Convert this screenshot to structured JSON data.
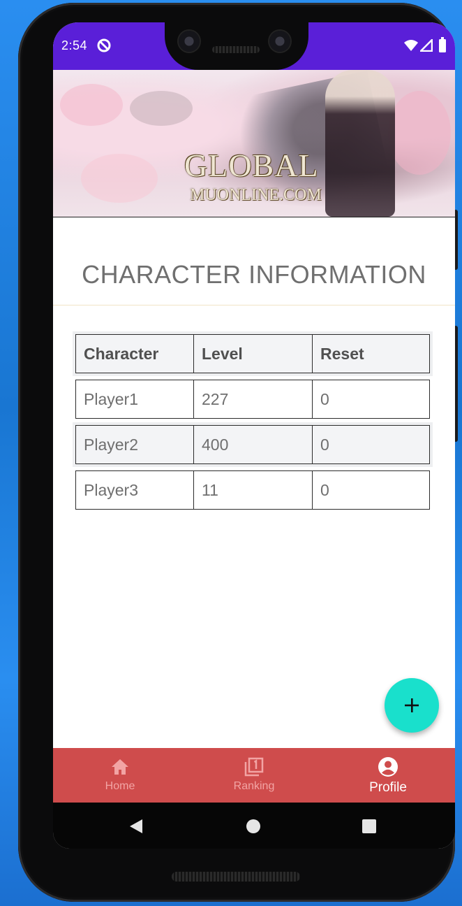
{
  "status_bar": {
    "time": "2:54",
    "icons": [
      "sync-icon",
      "wifi-icon",
      "signal-icon",
      "battery-icon"
    ]
  },
  "banner": {
    "logo_line1": "GLOBAL",
    "logo_line2": "MUONLINE.COM"
  },
  "page": {
    "title": "CHARACTER INFORMATION"
  },
  "table": {
    "headers": [
      "Character",
      "Level",
      "Reset"
    ],
    "rows": [
      [
        "Player1",
        "227",
        "0"
      ],
      [
        "Player2",
        "400",
        "0"
      ],
      [
        "Player3",
        "11",
        "0"
      ]
    ]
  },
  "fab": {
    "icon": "plus-icon"
  },
  "bottom_nav": {
    "items": [
      {
        "label": "Home",
        "icon": "home-icon",
        "active": false
      },
      {
        "label": "Ranking",
        "icon": "ranking-icon",
        "active": false
      },
      {
        "label": "Profile",
        "icon": "profile-icon",
        "active": true
      }
    ]
  },
  "system_nav": {
    "icons": [
      "back-icon",
      "home-circle-icon",
      "recents-icon"
    ]
  },
  "colors": {
    "status_bar": "#5a1fd8",
    "bottom_nav": "#cf4c4c",
    "fab": "#19e0cc",
    "desktop": "#1976d2"
  }
}
